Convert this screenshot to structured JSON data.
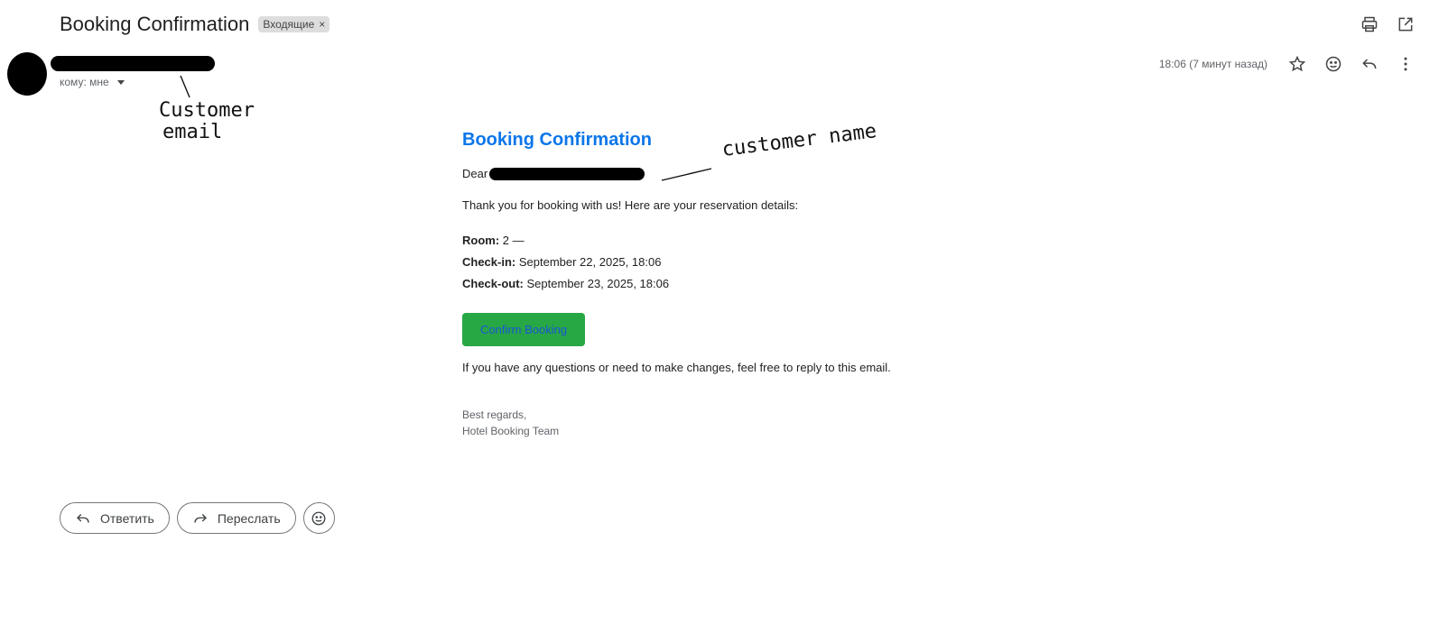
{
  "header": {
    "subject": "Booking Confirmation",
    "label": "Входящие",
    "label_remove": "×"
  },
  "sender": {
    "to_label": "кому: мне"
  },
  "meta": {
    "timestamp": "18:06 (7 минут назад)"
  },
  "annotations": {
    "email_note_line1": "Customer",
    "email_note_line2": "email",
    "name_note": "customer name"
  },
  "email": {
    "title": "Booking Confirmation",
    "greeting": "Dear",
    "intro": "Thank you for booking with us! Here are your reservation details:",
    "room_label": "Room:",
    "room_value": "2 —",
    "checkin_label": "Check-in:",
    "checkin_value": "September 22, 2025, 18:06",
    "checkout_label": "Check-out:",
    "checkout_value": "September 23, 2025, 18:06",
    "confirm_button": "Confirm Booking",
    "questions": "If you have any questions or need to make changes, feel free to reply to this email.",
    "regards": "Best regards,",
    "team": "Hotel Booking Team"
  },
  "actions": {
    "reply": "Ответить",
    "forward": "Переслать"
  },
  "icons": [
    "print-icon",
    "open-in-new-icon",
    "star-icon",
    "emoji-icon",
    "reply-icon",
    "more-vert-icon",
    "forward-icon"
  ],
  "colors": {
    "title_blue": "#0b76ea",
    "button_green": "#28a745",
    "button_text": "#1a56d6"
  }
}
